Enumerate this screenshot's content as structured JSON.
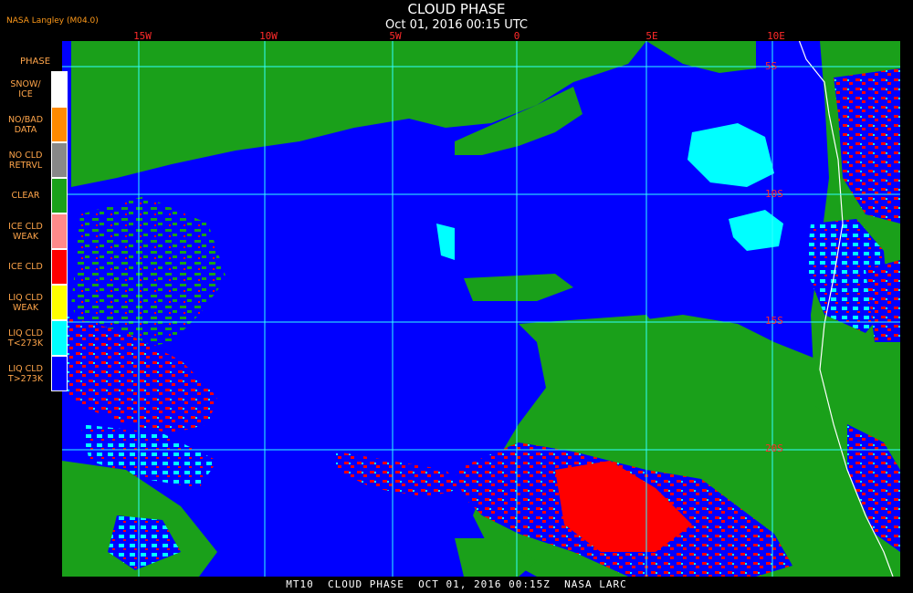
{
  "header": {
    "title": "CLOUD PHASE",
    "subtitle": "Oct 01, 2016 00:15 UTC",
    "credit": "NASA Langley (M04.0)"
  },
  "map": {
    "lon_labels": [
      "15W",
      "10W",
      "5W",
      "0",
      "5E",
      "10E"
    ],
    "lat_labels": [
      "5S",
      "10S",
      "15S",
      "20S"
    ]
  },
  "legend": {
    "title": "PHASE",
    "items": [
      {
        "label": "SNOW/ ICE",
        "color": "#ffffff"
      },
      {
        "label": "NO/BAD DATA",
        "color": "#ff8a00"
      },
      {
        "label": "NO CLD RETRVL",
        "color": "#888888"
      },
      {
        "label": "CLEAR",
        "color": "#1aa01a"
      },
      {
        "label": "ICE CLD WEAK",
        "color": "#ff8a8a"
      },
      {
        "label": "ICE CLD",
        "color": "#ff0000"
      },
      {
        "label": "LIQ CLD WEAK",
        "color": "#ffff00"
      },
      {
        "label": "LIQ CLD T<273K",
        "color": "#00ffff"
      },
      {
        "label": "LIQ CLD T>273K",
        "color": "#0000ff"
      }
    ]
  },
  "footer": {
    "text": "MT10  CLOUD PHASE  OCT 01, 2016 00:15Z  NASA LARC"
  }
}
